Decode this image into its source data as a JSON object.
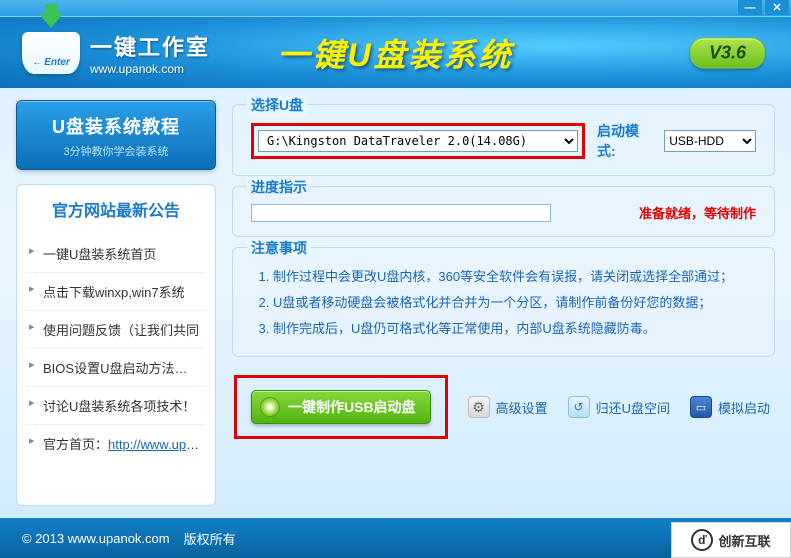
{
  "window": {
    "minimize": "—",
    "close": "✕"
  },
  "header": {
    "enter_label": "Enter",
    "brand_name": "一键工作室",
    "brand_url": "www.upanok.com",
    "main_title": "一键U盘装系统",
    "version": "V3.6"
  },
  "sidebar": {
    "tutorial_title": "U盘装系统教程",
    "tutorial_sub": "3分钟教你学会装系统",
    "news_heading": "官方网站最新公告",
    "items": [
      "一键U盘装系统首页",
      "点击下载winxp,win7系统",
      "使用问题反馈（让我们共同",
      "BIOS设置U盘启动方法…",
      "讨论U盘装系统各项技术！"
    ],
    "homepage_label": "官方首页：",
    "homepage_url": "http://www.upano"
  },
  "panel_select": {
    "label": "选择U盘",
    "usb_value": "G:\\Kingston DataTraveler 2.0(14.08G)",
    "boot_label": "启动模式:",
    "boot_value": "USB-HDD"
  },
  "panel_progress": {
    "label": "进度指示",
    "status": "准备就绪，等待制作"
  },
  "panel_notes": {
    "label": "注意事项",
    "items": [
      "制作过程中会更改U盘内核，360等安全软件会有误报，请关闭或选择全部通过；",
      "U盘或者移动硬盘会被格式化并合并为一个分区，请制作前备份好您的数据；",
      "制作完成后，U盘仍可格式化等正常使用，内部U盘系统隐藏防毒。"
    ]
  },
  "actions": {
    "make": "一键制作USB启动盘",
    "advanced": "高级设置",
    "restore": "归还U盘空间",
    "simulate": "模拟启动"
  },
  "footer": {
    "copyright": "© 2013 www.upanok.com",
    "rights": "版权所有"
  },
  "watermark": {
    "glyph": "ď",
    "text": "创新互联"
  }
}
